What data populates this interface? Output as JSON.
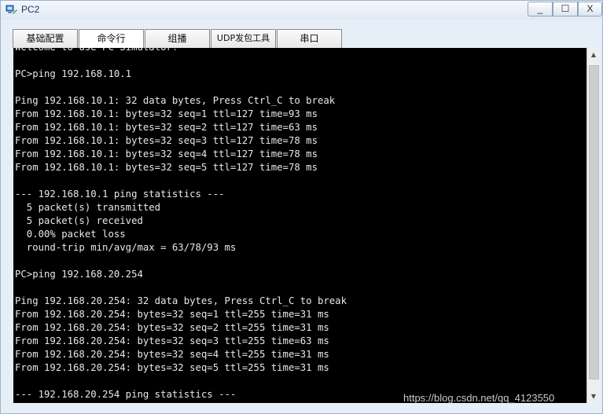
{
  "window": {
    "title": "PC2",
    "minimize_glyph": "_",
    "maximize_glyph": "☐",
    "close_glyph": "X"
  },
  "tabs": [
    {
      "label": "基础配置",
      "active": false
    },
    {
      "label": "命令行",
      "active": true
    },
    {
      "label": "组播",
      "active": false
    },
    {
      "label": "UDP发包工具",
      "active": false
    },
    {
      "label": "串口",
      "active": false
    }
  ],
  "terminal": {
    "lines": [
      "Welcome to use PC Simulator!",
      "",
      "PC>ping 192.168.10.1",
      "",
      "Ping 192.168.10.1: 32 data bytes, Press Ctrl_C to break",
      "From 192.168.10.1: bytes=32 seq=1 ttl=127 time=93 ms",
      "From 192.168.10.1: bytes=32 seq=2 ttl=127 time=63 ms",
      "From 192.168.10.1: bytes=32 seq=3 ttl=127 time=78 ms",
      "From 192.168.10.1: bytes=32 seq=4 ttl=127 time=78 ms",
      "From 192.168.10.1: bytes=32 seq=5 ttl=127 time=78 ms",
      "",
      "--- 192.168.10.1 ping statistics ---",
      "  5 packet(s) transmitted",
      "  5 packet(s) received",
      "  0.00% packet loss",
      "  round-trip min/avg/max = 63/78/93 ms",
      "",
      "PC>ping 192.168.20.254",
      "",
      "Ping 192.168.20.254: 32 data bytes, Press Ctrl_C to break",
      "From 192.168.20.254: bytes=32 seq=1 ttl=255 time=31 ms",
      "From 192.168.20.254: bytes=32 seq=2 ttl=255 time=31 ms",
      "From 192.168.20.254: bytes=32 seq=3 ttl=255 time=63 ms",
      "From 192.168.20.254: bytes=32 seq=4 ttl=255 time=31 ms",
      "From 192.168.20.254: bytes=32 seq=5 ttl=255 time=31 ms",
      "",
      "--- 192.168.20.254 ping statistics ---"
    ]
  },
  "scrollbar": {
    "up_glyph": "▲",
    "down_glyph": "▼"
  },
  "watermark": "https://blog.csdn.net/qq_4123550"
}
